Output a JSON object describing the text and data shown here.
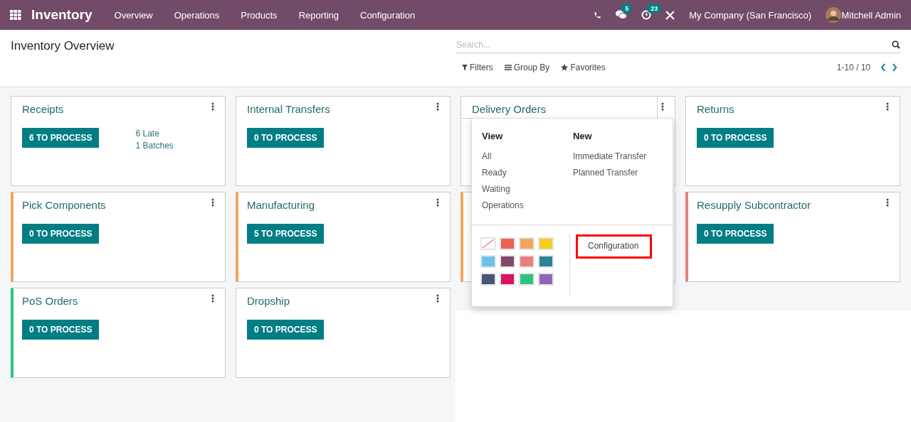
{
  "navbar": {
    "app_name": "Inventory",
    "menu": [
      "Overview",
      "Operations",
      "Products",
      "Reporting",
      "Configuration"
    ],
    "messages_badge": "5",
    "activities_badge": "23",
    "company": "My Company (San Francisco)",
    "user": "Mitchell Admin"
  },
  "control_panel": {
    "title": "Inventory Overview",
    "search": {
      "placeholder": "Search..."
    },
    "filters": [
      "Filters",
      "Group By",
      "Favorites"
    ],
    "pager": "1-10 / 10"
  },
  "cards": [
    {
      "title": "Receipts",
      "button": "6 TO PROCESS",
      "links": [
        "6 Late",
        "1 Batches"
      ],
      "menu_open": false
    },
    {
      "title": "Internal Transfers",
      "button": "0 TO PROCESS",
      "menu_open": false
    },
    {
      "title": "Delivery Orders",
      "menu_open": true
    },
    {
      "title": "Returns",
      "button": "0 TO PROCESS",
      "menu_open": false
    },
    {
      "title": "Pick Components",
      "button": "0 TO PROCESS",
      "color": "#f4a460",
      "menu_open": false
    },
    {
      "title": "Manufacturing",
      "button": "5 TO PROCESS",
      "color": "#f4a460",
      "menu_open": false
    },
    {
      "color": "#f4a460",
      "menu_open": false
    },
    {
      "title": "Resupply Subcontractor",
      "button": "0 TO PROCESS",
      "color": "#eb7e7f",
      "menu_open": false
    },
    {
      "title": "PoS Orders",
      "button": "0 TO PROCESS",
      "color": "#30c381",
      "menu_open": false
    },
    {
      "title": "Dropship",
      "button": "0 TO PROCESS",
      "menu_open": false
    }
  ],
  "card_menu": {
    "view_heading": "View",
    "view_items": [
      "All",
      "Ready",
      "Waiting",
      "Operations"
    ],
    "new_heading": "New",
    "new_items": [
      "Immediate Transfer",
      "Planned Transfer"
    ],
    "swatches": [
      {
        "kind": "none"
      },
      {
        "kind": "color",
        "color": "#f06050"
      },
      {
        "kind": "color",
        "color": "#f4a460"
      },
      {
        "kind": "color",
        "color": "#f7cd1f"
      },
      {
        "kind": "color",
        "color": "#6cc1ed"
      },
      {
        "kind": "color",
        "color": "#814968"
      },
      {
        "kind": "color",
        "color": "#eb7e7f"
      },
      {
        "kind": "color",
        "color": "#2c8397"
      },
      {
        "kind": "color",
        "color": "#475577"
      },
      {
        "kind": "color",
        "color": "#d6145f"
      },
      {
        "kind": "color",
        "color": "#30c381"
      },
      {
        "kind": "color",
        "color": "#9365b8"
      }
    ],
    "configuration": {
      "label": "Configuration",
      "highlighted": true
    }
  }
}
